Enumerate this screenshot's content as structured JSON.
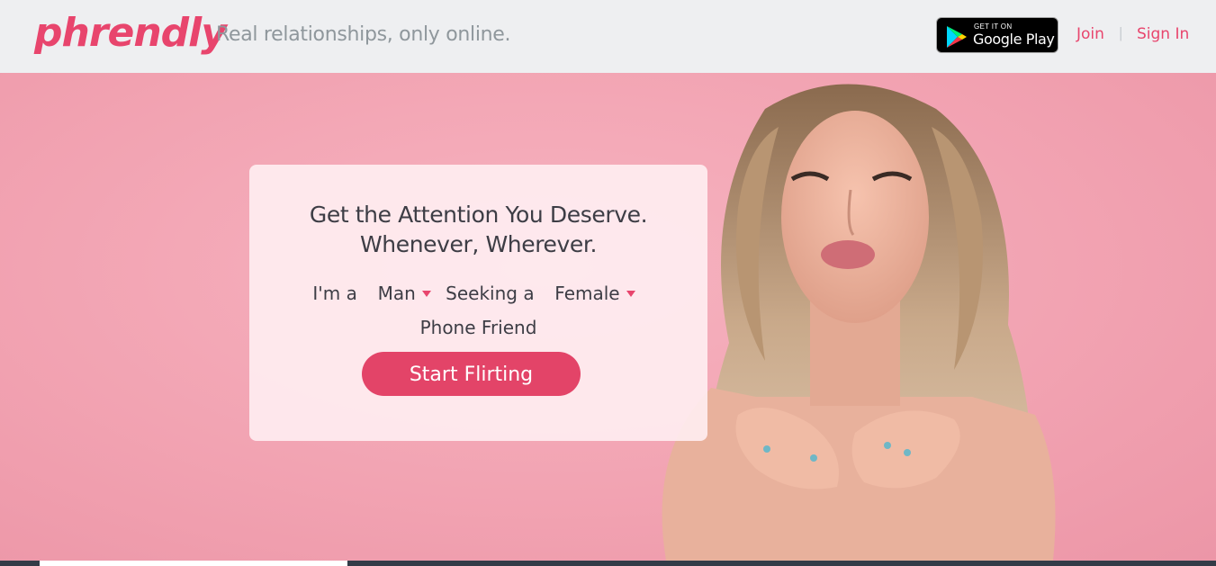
{
  "header": {
    "logo_text": "phrendly",
    "tagline": "Real relationships, only online.",
    "google_play": {
      "small": "GET IT ON",
      "big": "Google Play"
    },
    "join_label": "Join",
    "separator": "|",
    "signin_label": "Sign In"
  },
  "hero": {
    "headline_line1": "Get the Attention You Deserve.",
    "headline_line2": "Whenever, Wherever.",
    "im_a_label": "I'm a",
    "gender_value": "Man",
    "seeking_label": "Seeking a",
    "seeking_value": "Female",
    "relationship_type": "Phone Friend",
    "cta_label": "Start Flirting"
  },
  "colors": {
    "brand": "#e8456d",
    "cta": "#e34468",
    "hero_bg": "#f2a3b2",
    "header_bg": "#eeeff1"
  }
}
